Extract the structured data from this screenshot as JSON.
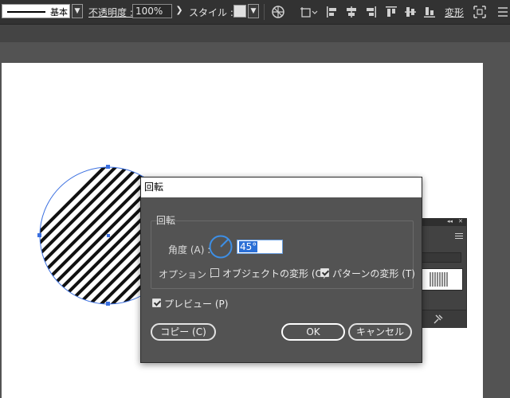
{
  "toolbar": {
    "stroke_profile": "基本",
    "opacity_label": "不透明度 :",
    "opacity_value": "100%",
    "style_label": "スタイル :",
    "transform_label": "変形",
    "icons": [
      "chevron-down-icon",
      "chevron-right-icon",
      "recolor-icon",
      "shape-mode-icon",
      "align-left-icon",
      "align-hcenter-icon",
      "align-right-icon",
      "align-top-icon",
      "align-vcenter-icon",
      "align-bottom-icon",
      "transform-grid-icon"
    ]
  },
  "dialog": {
    "title": "回転",
    "group_label": "回転",
    "angle_label": "角度 (A) :",
    "angle_value": "45°",
    "options_label": "オプション :",
    "transform_objects": {
      "label": "オブジェクトの変形 (O)",
      "checked": false
    },
    "transform_patterns": {
      "label": "パターンの変形 (T)",
      "checked": true
    },
    "preview": {
      "label": "プレビュー (P)",
      "checked": true
    },
    "buttons": {
      "copy": "コピー (C)",
      "ok": "OK",
      "cancel": "キャンセル"
    }
  },
  "colors": {
    "selection": "#3a6fe0",
    "canvas": "#535353",
    "toolbar": "#323232"
  }
}
